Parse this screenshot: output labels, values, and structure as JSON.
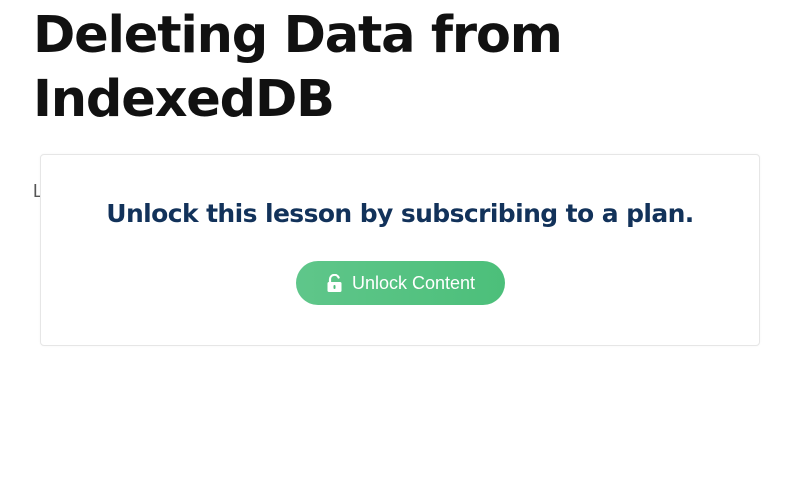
{
  "page": {
    "title": "Deleting Data from IndexedDB",
    "hidden_text_fragment": "L"
  },
  "paywall": {
    "message": "Unlock this lesson by subscribing to a plan.",
    "button_label": "Unlock Content",
    "button_icon": "unlock-icon",
    "title_color": "#12325a",
    "button_color": "#4cbf7a"
  }
}
